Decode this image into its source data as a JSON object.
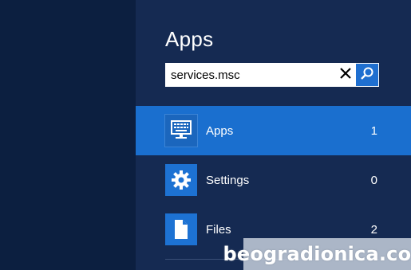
{
  "charm": {
    "title": "Apps"
  },
  "search": {
    "value": "services.msc",
    "clear_icon": "close-icon",
    "search_icon": "search-icon"
  },
  "results": [
    {
      "label": "Apps",
      "count": "1",
      "icon": "apps-keyboard-monitor-icon",
      "selected": true
    },
    {
      "label": "Settings",
      "count": "0",
      "icon": "gear-icon",
      "selected": false
    },
    {
      "label": "Files",
      "count": "2",
      "icon": "file-icon",
      "selected": false
    }
  ],
  "watermark": {
    "text": "beogradionica.com"
  },
  "colors": {
    "background": "#0b1e3e",
    "pane": "#152a52",
    "accent": "#1a6fcf",
    "tile": "#1d72d3"
  }
}
